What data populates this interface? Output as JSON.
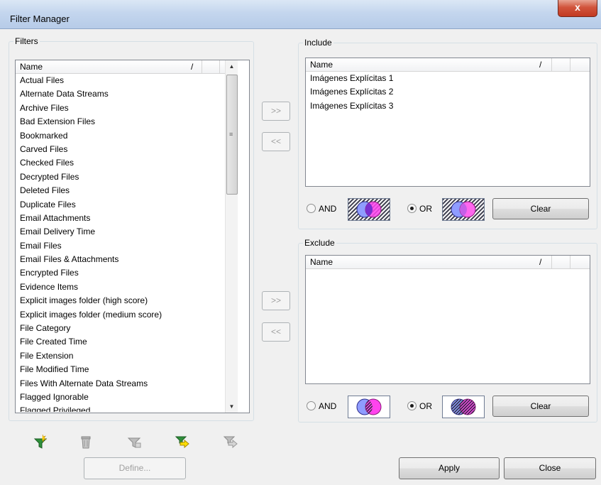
{
  "window": {
    "title": "Filter Manager",
    "close_glyph": "x"
  },
  "filters": {
    "legend": "Filters",
    "column_name": "Name",
    "sort_glyph": "/",
    "items": [
      "Actual Files",
      "Alternate Data Streams",
      "Archive Files",
      "Bad Extension Files",
      "Bookmarked",
      "Carved Files",
      "Checked Files",
      "Decrypted Files",
      "Deleted Files",
      "Duplicate Files",
      "Email Attachments",
      "Email Delivery Time",
      "Email Files",
      "Email Files & Attachments",
      "Encrypted Files",
      "Evidence Items",
      "Explicit images folder (high score)",
      "Explicit images folder (medium score)",
      "File Category",
      "File Created Time",
      "File Extension",
      "File Modified Time",
      "Files With Alternate Data Streams",
      "Flagged Ignorable",
      "Flagged Privileged"
    ],
    "scrollbar": {
      "up_glyph": "▲",
      "down_glyph": "▼",
      "grip_glyph": "≡"
    }
  },
  "include": {
    "legend": "Include",
    "column_name": "Name",
    "sort_glyph": "/",
    "items": [
      "Imágenes Explícitas 1",
      "Imágenes Explícitas 2",
      "Imágenes Explícitas 3"
    ],
    "and_label": "AND",
    "or_label": "OR",
    "selected_mode": "OR",
    "clear_label": "Clear",
    "add_label": ">>",
    "remove_label": "<<"
  },
  "exclude": {
    "legend": "Exclude",
    "column_name": "Name",
    "sort_glyph": "/",
    "items": [],
    "and_label": "AND",
    "or_label": "OR",
    "selected_mode": "OR",
    "clear_label": "Clear",
    "add_label": ">>",
    "remove_label": "<<"
  },
  "toolbar": {
    "icons": [
      "new-filter-icon",
      "delete-filter-icon",
      "edit-filter-icon",
      "import-filter-icon",
      "export-filter-icon"
    ]
  },
  "footer": {
    "define_label": "Define...",
    "apply_label": "Apply",
    "close_label": "Close"
  },
  "colors": {
    "accent_blue": "#6b7cff",
    "accent_magenta": "#ff2be8",
    "hatch": "#404050"
  }
}
